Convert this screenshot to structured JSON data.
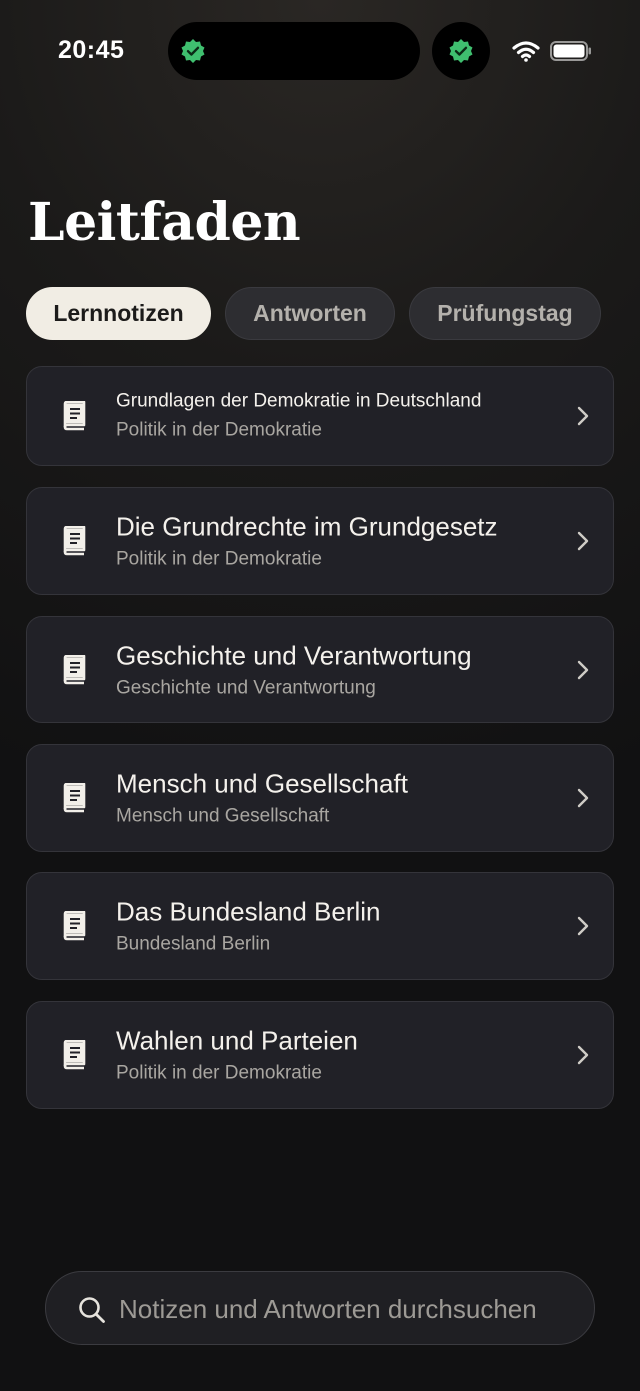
{
  "status": {
    "time": "20:45"
  },
  "title": "Leitfaden",
  "tabs": [
    {
      "label": "Lernnotizen",
      "active": true
    },
    {
      "label": "Antworten",
      "active": false
    },
    {
      "label": "Prüfungstag",
      "active": false
    }
  ],
  "notes": [
    {
      "title": "Grundlagen der Demokratie in Deutschland",
      "subtitle": "Politik in der Demokratie"
    },
    {
      "title": "Die Grundrechte im Grundgesetz",
      "subtitle": "Politik in der Demokratie"
    },
    {
      "title": "Geschichte und Verantwortung",
      "subtitle": "Geschichte und Verantwortung"
    },
    {
      "title": "Mensch und Gesellschaft",
      "subtitle": "Mensch und Gesellschaft"
    },
    {
      "title": "Das Bundesland Berlin",
      "subtitle": "Bundesland Berlin"
    },
    {
      "title": "Wahlen und Parteien",
      "subtitle": "Politik in der Demokratie"
    }
  ],
  "search": {
    "placeholder": "Notizen und Antworten durchsuchen"
  },
  "icons": {
    "note": "book-icon",
    "chevron": "chevron-right-icon",
    "search": "search-icon"
  },
  "colors": {
    "accent": "#f1ede4",
    "verified": "#3fbf6f",
    "card": "#212127"
  }
}
